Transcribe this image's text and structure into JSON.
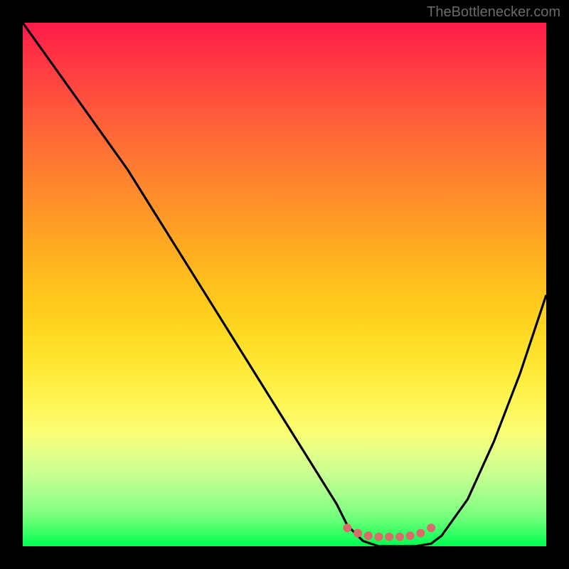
{
  "attribution": "TheBottlenecker.com",
  "chart_data": {
    "type": "line",
    "title": "",
    "xlabel": "",
    "ylabel": "",
    "xlim": [
      0,
      100
    ],
    "ylim": [
      0,
      100
    ],
    "series": [
      {
        "name": "bottleneck-curve",
        "x": [
          0,
          5,
          10,
          15,
          20,
          25,
          30,
          35,
          40,
          45,
          50,
          55,
          60,
          62,
          65,
          68,
          70,
          72,
          75,
          78,
          80,
          85,
          90,
          95,
          100
        ],
        "y": [
          100,
          93,
          86,
          79,
          72,
          64,
          56,
          48,
          40,
          32,
          24,
          16,
          8,
          4,
          1,
          0,
          0,
          0,
          0,
          0.5,
          2,
          9,
          20,
          33,
          48
        ]
      },
      {
        "name": "highlight-dots",
        "x": [
          62,
          64,
          66,
          68,
          70,
          72,
          74,
          76,
          78
        ],
        "y": [
          3.5,
          2.5,
          2,
          1.8,
          1.8,
          1.8,
          2,
          2.5,
          3.5
        ]
      }
    ],
    "colors": {
      "curve": "#000000",
      "dots": "#d96b6b",
      "gradient_top": "#ff1a4b",
      "gradient_bottom": "#00ff52"
    }
  }
}
